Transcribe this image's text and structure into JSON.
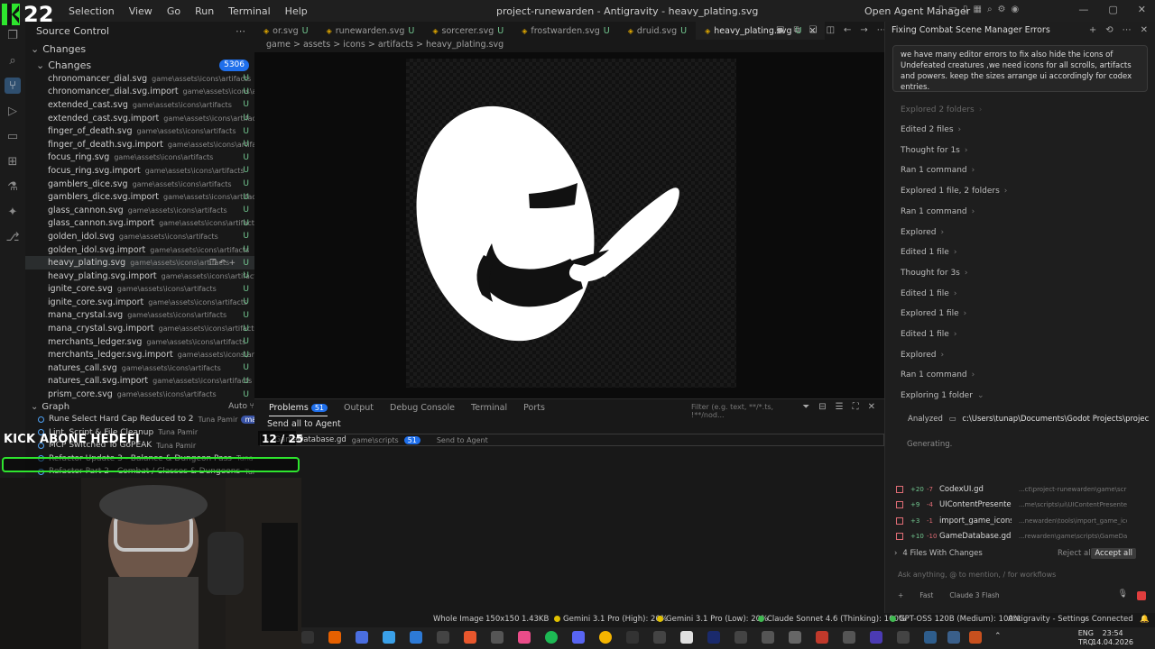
{
  "titlebar": {
    "menu": [
      "Selection",
      "View",
      "Go",
      "Run",
      "Terminal",
      "Help"
    ],
    "window_title": "project-runewarden - Antigravity - heavy_plating.svg",
    "agent_manager": "Open Agent Manager"
  },
  "scm": {
    "title": "Source Control",
    "changes_label": "Changes",
    "changes_sub": "Changes",
    "count": "5306",
    "files": [
      {
        "name": "chronomancer_dial.svg",
        "path": "game\\assets\\icons\\artifacts",
        "status": "U"
      },
      {
        "name": "chronomancer_dial.svg.import",
        "path": "game\\assets\\icons\\artifa...",
        "status": "U"
      },
      {
        "name": "extended_cast.svg",
        "path": "game\\assets\\icons\\artifacts",
        "status": "U"
      },
      {
        "name": "extended_cast.svg.import",
        "path": "game\\assets\\icons\\artifacts",
        "status": "U"
      },
      {
        "name": "finger_of_death.svg",
        "path": "game\\assets\\icons\\artifacts",
        "status": "U"
      },
      {
        "name": "finger_of_death.svg.import",
        "path": "game\\assets\\icons\\artifacts",
        "status": "U"
      },
      {
        "name": "focus_ring.svg",
        "path": "game\\assets\\icons\\artifacts",
        "status": "U"
      },
      {
        "name": "focus_ring.svg.import",
        "path": "game\\assets\\icons\\artifacts",
        "status": "U"
      },
      {
        "name": "gamblers_dice.svg",
        "path": "game\\assets\\icons\\artifacts",
        "status": "U"
      },
      {
        "name": "gamblers_dice.svg.import",
        "path": "game\\assets\\icons\\artifacts",
        "status": "U"
      },
      {
        "name": "glass_cannon.svg",
        "path": "game\\assets\\icons\\artifacts",
        "status": "U"
      },
      {
        "name": "glass_cannon.svg.import",
        "path": "game\\assets\\icons\\artifacts",
        "status": "U"
      },
      {
        "name": "golden_idol.svg",
        "path": "game\\assets\\icons\\artifacts",
        "status": "U"
      },
      {
        "name": "golden_idol.svg.import",
        "path": "game\\assets\\icons\\artifacts",
        "status": "U"
      },
      {
        "name": "heavy_plating.svg",
        "path": "game\\assets\\icons\\artifacts",
        "status": "U"
      },
      {
        "name": "heavy_plating.svg.import",
        "path": "game\\assets\\icons\\artifacts",
        "status": "U"
      },
      {
        "name": "ignite_core.svg",
        "path": "game\\assets\\icons\\artifacts",
        "status": "U"
      },
      {
        "name": "ignite_core.svg.import",
        "path": "game\\assets\\icons\\artifacts",
        "status": "U"
      },
      {
        "name": "mana_crystal.svg",
        "path": "game\\assets\\icons\\artifacts",
        "status": "U"
      },
      {
        "name": "mana_crystal.svg.import",
        "path": "game\\assets\\icons\\artifacts",
        "status": "U"
      },
      {
        "name": "merchants_ledger.svg",
        "path": "game\\assets\\icons\\artifacts",
        "status": "U"
      },
      {
        "name": "merchants_ledger.svg.import",
        "path": "game\\assets\\icons\\artifacts",
        "status": "U"
      },
      {
        "name": "natures_call.svg",
        "path": "game\\assets\\icons\\artifacts",
        "status": "U"
      },
      {
        "name": "natures_call.svg.import",
        "path": "game\\assets\\icons\\artifacts",
        "status": "U"
      },
      {
        "name": "prism_core.svg",
        "path": "game\\assets\\icons\\artifacts",
        "status": "U"
      }
    ]
  },
  "graph": {
    "title": "Graph",
    "mode": "Auto",
    "commits": [
      {
        "msg": "Rune Select Hard Cap Reduced to 2",
        "author": "Tuna Pamir",
        "branch": "main"
      },
      {
        "msg": "Lint, Script & File Cleanup",
        "author": "Tuna Pamir",
        "branch": ""
      },
      {
        "msg": "MCP Switched To GoPEAK",
        "author": "Tuna Pamir",
        "branch": ""
      },
      {
        "msg": "Refactor Update 3 - Balance & Dungeon Pass",
        "author": "Tuna Pamir",
        "branch": ""
      },
      {
        "msg": "Refactor Part 2 - Combat / Classes & Dungeons",
        "author": "Tuna Pamir",
        "branch": ""
      }
    ]
  },
  "tabs": [
    {
      "label": "or.svg",
      "status": "U",
      "active": false
    },
    {
      "label": "runewarden.svg",
      "status": "U",
      "active": false
    },
    {
      "label": "sorcerer.svg",
      "status": "U",
      "active": false
    },
    {
      "label": "frostwarden.svg",
      "status": "U",
      "active": false
    },
    {
      "label": "druid.svg",
      "status": "U",
      "active": false
    },
    {
      "label": "heavy_plating.svg",
      "status": "U",
      "active": true
    }
  ],
  "breadcrumb": "game > assets > icons > artifacts > heavy_plating.svg",
  "panel": {
    "tabs": [
      "Problems",
      "Output",
      "Debug Console",
      "Terminal",
      "Ports"
    ],
    "problems_count": "51",
    "filter_placeholder": "Filter (e.g. text, **/*.ts, !**/nod...",
    "send_all": "Send all to Agent",
    "problem_file": "GameDatabase.gd",
    "problem_path": "game\\scripts",
    "problem_count": "51",
    "send_to_agent": "Send to Agent"
  },
  "agent": {
    "title": "Fixing Combat Scene Manager Errors",
    "prompt": "we have many editor errors to fix also hide the icons of Undefeated creatures ,we need icons for all scrolls, artifacts and powers. keep the sizes arrange ui accordingly for codex entries.",
    "steps": [
      {
        "text": "Explored 2 folders"
      },
      {
        "text": "Edited 2 files"
      },
      {
        "text": "Thought for 1s"
      },
      {
        "text": "Ran 1 command"
      },
      {
        "text": "Explored 1 file, 2 folders"
      },
      {
        "text": "Ran 1 command"
      },
      {
        "text": "Explored"
      },
      {
        "text": "Edited 1 file"
      },
      {
        "text": "Thought for 3s"
      },
      {
        "text": "Edited 1 file"
      },
      {
        "text": "Explored 1 file"
      },
      {
        "text": "Edited 1 file"
      },
      {
        "text": "Explored"
      },
      {
        "text": "Ran 1 command"
      },
      {
        "text": "Exploring 1 folder"
      }
    ],
    "analyzed_label": "Analyzed",
    "analyzed_path": "c:\\Users\\tunap\\Documents\\Godot Projects\\projec",
    "generating": "Generating.",
    "changed_files": [
      {
        "add": "+20",
        "del": "-7",
        "name": "CodexUI.gd",
        "path": "...ct\\project-runewarden\\game\\scripts\\CodexUI.gd"
      },
      {
        "add": "+9",
        "del": "-4",
        "name": "UIContentPresenter.gd",
        "path": "...me\\scripts\\ui\\UIContentPresenter.gd"
      },
      {
        "add": "+3",
        "del": "-1",
        "name": "import_game_icons.js",
        "path": "...newarden\\tools\\import_game_icons.js"
      },
      {
        "add": "+10",
        "del": "-10",
        "name": "GameDatabase.gd",
        "path": "...rewarden\\game\\scripts\\GameDatabase.gd"
      }
    ],
    "files_with_changes": "4 Files With Changes",
    "reject_all": "Reject all",
    "accept_all": "Accept all",
    "ask_placeholder": "Ask anything, @ to mention, / for workflows",
    "mode": "Fast",
    "model": "Claude 3 Flash"
  },
  "statusbar": {
    "whole_image": "Whole Image",
    "dims": "150x150",
    "size": "1.43KB",
    "quota1": "Gemini 3.1 Pro (High): 20%",
    "quota2": "Gemini 3.1 Pro (Low): 20%",
    "quota3": "Claude Sonnet 4.6 (Thinking): 100%",
    "quota4": "GPT-OSS 120B (Medium): 100%",
    "settings": "Antigravity - Settings",
    "connected": "Connected"
  },
  "taskbar": {
    "lang1": "ENG",
    "lang2": "TRQ",
    "time": "23:54",
    "date": "14.04.2026"
  },
  "overlay": {
    "logo": "22",
    "kick_text": "KICK ABONE HEDEFI",
    "kick_count": "12 / 25"
  },
  "colors": {
    "accent": "#1f6feb",
    "untracked": "#73c991",
    "kick_green": "#2ee52e"
  }
}
